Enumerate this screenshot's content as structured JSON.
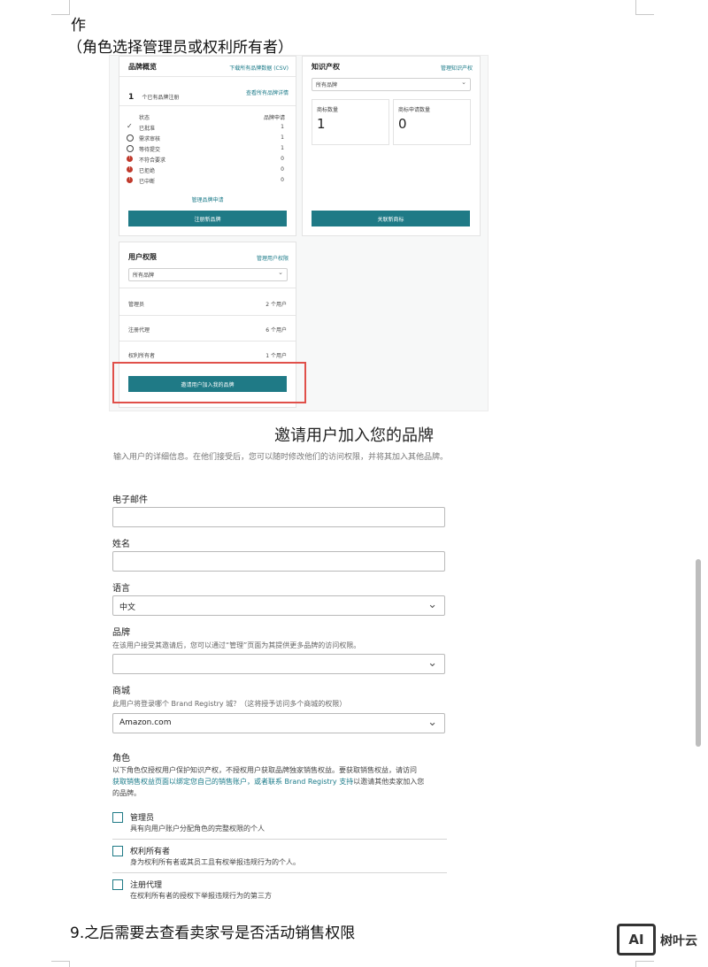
{
  "doc": {
    "line1": "作",
    "line2": "（角色选择管理员或权利所有者）",
    "footer_step": "9.之后需要去查看卖家号是否活动销售权限"
  },
  "brand_overview": {
    "title": "品牌概览",
    "link": "下载所有品牌数据 (CSV)",
    "count": "1",
    "count_label": "个已有品牌注册",
    "count_link": "查看所有品牌详情",
    "col_status": "状态",
    "col_requests": "品牌申请",
    "statuses": [
      {
        "icon": "check",
        "label": "已批准",
        "count": "1"
      },
      {
        "icon": "clock",
        "label": "需求审核",
        "count": "1"
      },
      {
        "icon": "clock",
        "label": "等待提交",
        "count": "1"
      },
      {
        "icon": "alert",
        "label": "不符合要求",
        "count": "0"
      },
      {
        "icon": "alert",
        "label": "已拒绝",
        "count": "0"
      },
      {
        "icon": "alert",
        "label": "已中断",
        "count": "0"
      }
    ],
    "manage_link": "管理品牌申请",
    "button": "注册新品牌"
  },
  "ip": {
    "title": "知识产权",
    "link": "管理知识产权",
    "select_value": "所有品牌",
    "stat1_label": "商标数量",
    "stat1_value": "1",
    "stat2_label": "商标申请数量",
    "stat2_value": "0",
    "button": "关联新商标"
  },
  "user_perms": {
    "title": "用户权限",
    "link": "管理用户权限",
    "select_value": "所有品牌",
    "rows": [
      {
        "label": "管理员",
        "value": "2 个用户"
      },
      {
        "label": "注册代理",
        "value": "6 个用户"
      },
      {
        "label": "权利所有者",
        "value": "1 个用户"
      }
    ],
    "button": "邀请用户加入我的品牌"
  },
  "form": {
    "title": "邀请用户加入您的品牌",
    "desc": "输入用户的详细信息。在他们接受后，您可以随时修改他们的访问权限，并将其加入其他品牌。",
    "email_label": "电子邮件",
    "name_label": "姓名",
    "lang_label": "语言",
    "lang_value": "中文",
    "brand_label": "品牌",
    "brand_help": "在该用户接受其邀请后，您可以通过“管理”页面为其提供更多品牌的访问权限。",
    "market_label": "商城",
    "market_help": "此用户将登录哪个 Brand Registry 城？（这将授予访问多个商城的权限）",
    "market_value": "Amazon.com",
    "role_label": "角色",
    "role_help_1": "以下角色仅授权用户保护知识产权，不授权用户获取品牌独家销售权益。要获取销售权益，请访问",
    "role_help_2a": "获取销售权益页面以绑定您自己的销售账户，或者联系 ",
    "role_help_2_link": "Brand Registry 支持",
    "role_help_2b": "以邀请其他卖家加入您",
    "role_help_3": "的品牌。",
    "roles": [
      {
        "title": "管理员",
        "desc": "具有向用户账户分配角色的完整权限的个人"
      },
      {
        "title": "权利所有者",
        "desc": "身为权利所有者或其员工且有权举报违规行为的个人。"
      },
      {
        "title": "注册代理",
        "desc": "在权利所有者的授权下举报违规行为的第三方"
      }
    ]
  },
  "watermark": {
    "logo": "AI",
    "text": "树叶云"
  },
  "colors": {
    "teal": "#1f7a86",
    "highlight": "#e0504a"
  }
}
